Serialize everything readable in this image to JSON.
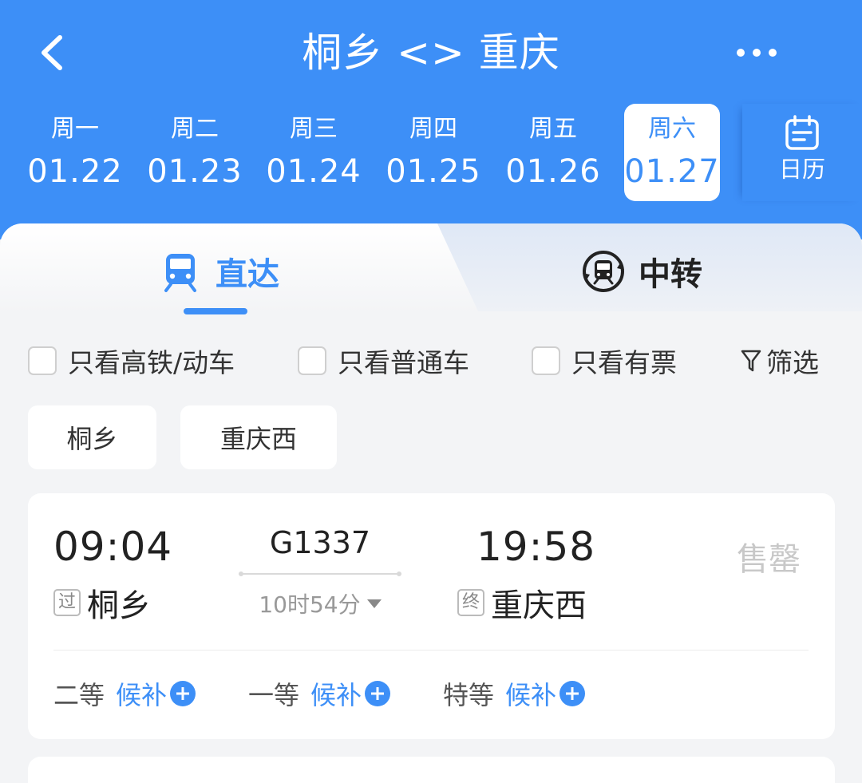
{
  "header": {
    "title": "桐乡 <> 重庆",
    "back_icon": "chevron-left-icon",
    "more_icon": "more-dots-icon"
  },
  "dates": [
    {
      "dow": "周一",
      "date": "01.22",
      "active": false
    },
    {
      "dow": "周二",
      "date": "01.23",
      "active": false
    },
    {
      "dow": "周三",
      "date": "01.24",
      "active": false
    },
    {
      "dow": "周四",
      "date": "01.25",
      "active": false
    },
    {
      "dow": "周五",
      "date": "01.26",
      "active": false
    },
    {
      "dow": "周六",
      "date": "01.27",
      "active": true
    }
  ],
  "calendar": {
    "label": "日历",
    "icon": "calendar-icon"
  },
  "tabs": {
    "direct": {
      "label": "直达",
      "icon": "train-icon",
      "active": true
    },
    "transfer": {
      "label": "中转",
      "icon": "transfer-train-icon",
      "active": false
    }
  },
  "filters": {
    "high_speed_only": "只看高铁/动车",
    "regular_only": "只看普通车",
    "available_only": "只看有票",
    "filter_label": "筛选",
    "filter_icon": "funnel-icon"
  },
  "station_chips": [
    "桐乡",
    "重庆西"
  ],
  "train": {
    "departure_time": "09:04",
    "arrival_time": "19:58",
    "train_number": "G1337",
    "duration": "10时54分",
    "departure_tag": "过",
    "departure_station": "桐乡",
    "arrival_tag": "终",
    "arrival_station": "重庆西",
    "status": "售罄",
    "seats": [
      {
        "class": "二等",
        "action": "候补"
      },
      {
        "class": "一等",
        "action": "候补"
      },
      {
        "class": "特等",
        "action": "候补"
      }
    ]
  },
  "colors": {
    "primary": "#3d8ff7",
    "background": "#f3f4f6",
    "sold_out": "#c8c8c8"
  }
}
